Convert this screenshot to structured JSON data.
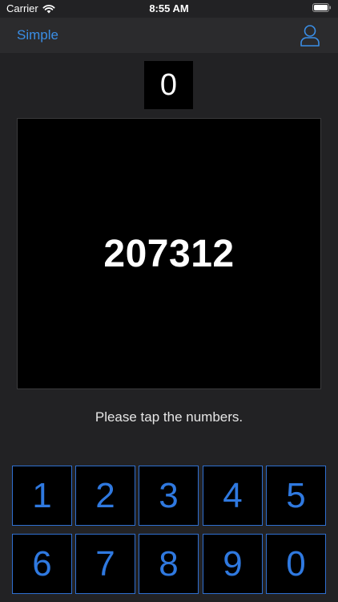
{
  "status_bar": {
    "carrier": "Carrier",
    "time": "8:55 AM",
    "wifi_icon": "wifi-icon",
    "battery_icon": "battery-icon"
  },
  "nav": {
    "left_label": "Simple",
    "right_icon": "person-icon"
  },
  "counter": "0",
  "display_number": "207312",
  "instruction": "Please tap the numbers.",
  "keypad": {
    "keys": [
      "1",
      "2",
      "3",
      "4",
      "5",
      "6",
      "7",
      "8",
      "9",
      "0"
    ]
  },
  "colors": {
    "background": "#222224",
    "nav_background": "#2b2b2d",
    "accent": "#3a8ee6",
    "key_border": "#2f6fd0",
    "key_text": "#2f79e0"
  }
}
